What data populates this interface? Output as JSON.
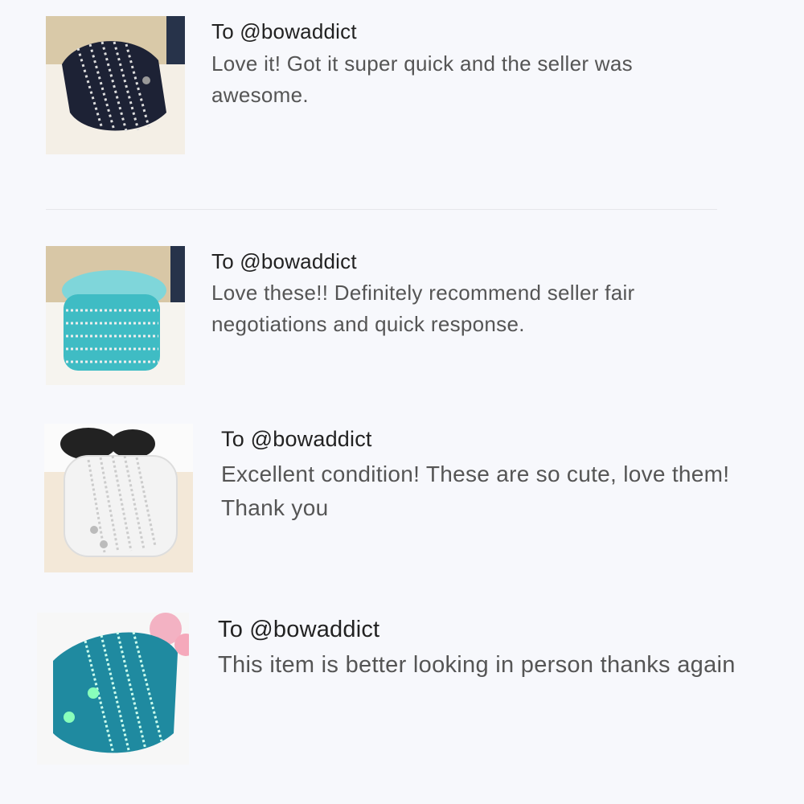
{
  "reviews": [
    {
      "recipient": "To @bowaddict",
      "message": "Love it! Got it super quick and the seller was awesome.",
      "thumbnail_icon": "black-studded-wrap-bracelet",
      "band_color": "#1d2235"
    },
    {
      "recipient": "To @bowaddict",
      "message": "Love these!! Definitely recommend seller fair negotiations and quick response.",
      "thumbnail_icon": "turquoise-studded-wrap-bracelet",
      "band_color": "#3fbcc4"
    },
    {
      "recipient": "To @bowaddict",
      "message": "Excellent condition! These are so cute, love them! Thank you",
      "thumbnail_icon": "white-studded-wrap-bracelet",
      "band_color": "#f3f3f3"
    },
    {
      "recipient": "To @bowaddict",
      "message": "This item is better looking in person thanks again",
      "thumbnail_icon": "teal-studded-wrap-bracelet",
      "band_color": "#1f8aa0"
    }
  ]
}
